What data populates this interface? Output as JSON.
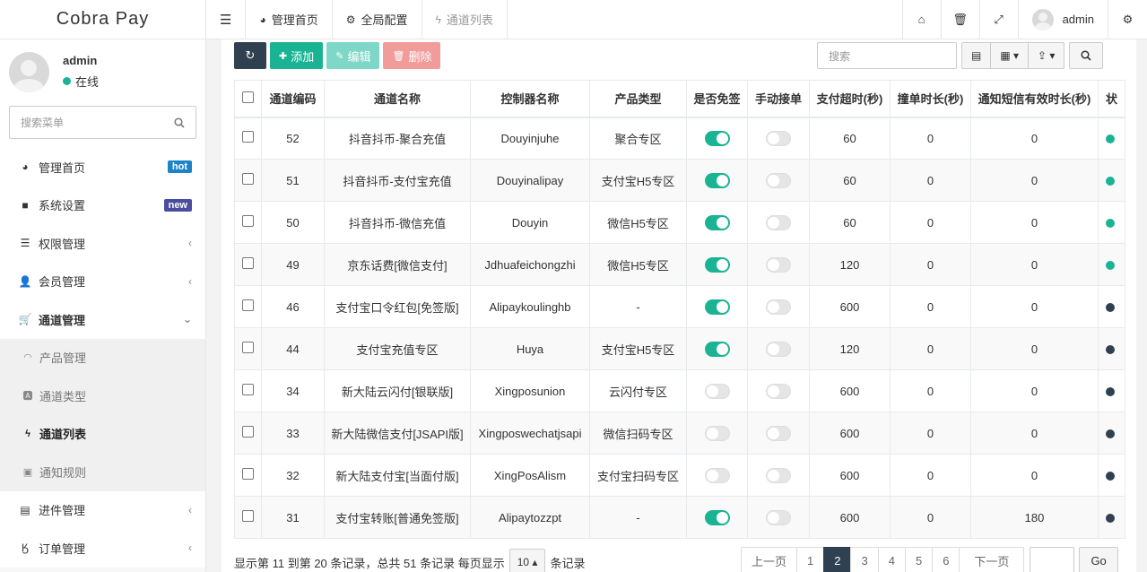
{
  "brand": "Cobra Pay",
  "user": {
    "name": "admin",
    "status": "在线"
  },
  "sidebar": {
    "search_placeholder": "搜索菜单",
    "items": [
      {
        "label": "管理首页",
        "badge": "hot"
      },
      {
        "label": "系统设置",
        "badge": "new"
      },
      {
        "label": "权限管理"
      },
      {
        "label": "会员管理"
      },
      {
        "label": "通道管理"
      }
    ],
    "subitems": [
      {
        "label": "产品管理"
      },
      {
        "label": "通道类型"
      },
      {
        "label": "通道列表"
      },
      {
        "label": "通知规则"
      }
    ],
    "bottom": [
      {
        "label": "进件管理"
      },
      {
        "label": "订单管理"
      }
    ]
  },
  "topbar": {
    "tabs": [
      {
        "label": "管理首页"
      },
      {
        "label": "全局配置"
      },
      {
        "label": "通道列表"
      }
    ],
    "user": "admin"
  },
  "toolbar": {
    "add": "添加",
    "edit": "编辑",
    "delete": "删除",
    "search_placeholder": "搜索"
  },
  "table": {
    "columns": [
      "通道编码",
      "通道名称",
      "控制器名称",
      "产品类型",
      "是否免签",
      "手动接单",
      "支付超时(秒)",
      "撞单时长(秒)",
      "通知短信有效时长(秒)",
      "状"
    ],
    "rows": [
      {
        "code": "52",
        "name": "抖音抖币-聚合充值",
        "controller": "Douyinjuhe",
        "product": "聚合专区",
        "free": true,
        "manual": false,
        "timeout": "60",
        "collide": "0",
        "sms": "0",
        "status_color": "#1ab394"
      },
      {
        "code": "51",
        "name": "抖音抖币-支付宝充值",
        "controller": "Douyinalipay",
        "product": "支付宝H5专区",
        "free": true,
        "manual": false,
        "timeout": "60",
        "collide": "0",
        "sms": "0",
        "status_color": "#1ab394"
      },
      {
        "code": "50",
        "name": "抖音抖币-微信充值",
        "controller": "Douyin",
        "product": "微信H5专区",
        "free": true,
        "manual": false,
        "timeout": "60",
        "collide": "0",
        "sms": "0",
        "status_color": "#1ab394"
      },
      {
        "code": "49",
        "name": "京东话费[微信支付]",
        "controller": "Jdhuafeichongzhi",
        "product": "微信H5专区",
        "free": true,
        "manual": false,
        "timeout": "120",
        "collide": "0",
        "sms": "0",
        "status_color": "#1ab394"
      },
      {
        "code": "46",
        "name": "支付宝口令红包[免签版]",
        "controller": "Alipaykoulinghb",
        "product": "-",
        "free": true,
        "manual": false,
        "timeout": "600",
        "collide": "0",
        "sms": "0",
        "status_color": "#2f4050"
      },
      {
        "code": "44",
        "name": "支付宝充值专区",
        "controller": "Huya",
        "product": "支付宝H5专区",
        "free": true,
        "manual": false,
        "timeout": "120",
        "collide": "0",
        "sms": "0",
        "status_color": "#2f4050"
      },
      {
        "code": "34",
        "name": "新大陆云闪付[银联版]",
        "controller": "Xingposunion",
        "product": "云闪付专区",
        "free": false,
        "manual": false,
        "timeout": "600",
        "collide": "0",
        "sms": "0",
        "status_color": "#2f4050"
      },
      {
        "code": "33",
        "name": "新大陆微信支付[JSAPI版]",
        "controller": "Xingposwechatjsapi",
        "product": "微信扫码专区",
        "free": false,
        "manual": false,
        "timeout": "600",
        "collide": "0",
        "sms": "0",
        "status_color": "#2f4050"
      },
      {
        "code": "32",
        "name": "新大陆支付宝[当面付版]",
        "controller": "XingPosAlism",
        "product": "支付宝扫码专区",
        "free": false,
        "manual": false,
        "timeout": "600",
        "collide": "0",
        "sms": "0",
        "status_color": "#2f4050"
      },
      {
        "code": "31",
        "name": "支付宝转账[普通免签版]",
        "controller": "Alipaytozzpt",
        "product": "-",
        "free": true,
        "manual": false,
        "timeout": "600",
        "collide": "0",
        "sms": "180",
        "status_color": "#2f4050"
      }
    ]
  },
  "pager": {
    "info_prefix": "显示第 11 到第 20 条记录，总共 51 条记录 每页显示",
    "page_size": "10",
    "info_suffix": "条记录",
    "prev": "上一页",
    "pages": [
      "1",
      "2",
      "3",
      "4",
      "5",
      "6"
    ],
    "active_page": "2",
    "next": "下一页",
    "go": "Go"
  }
}
